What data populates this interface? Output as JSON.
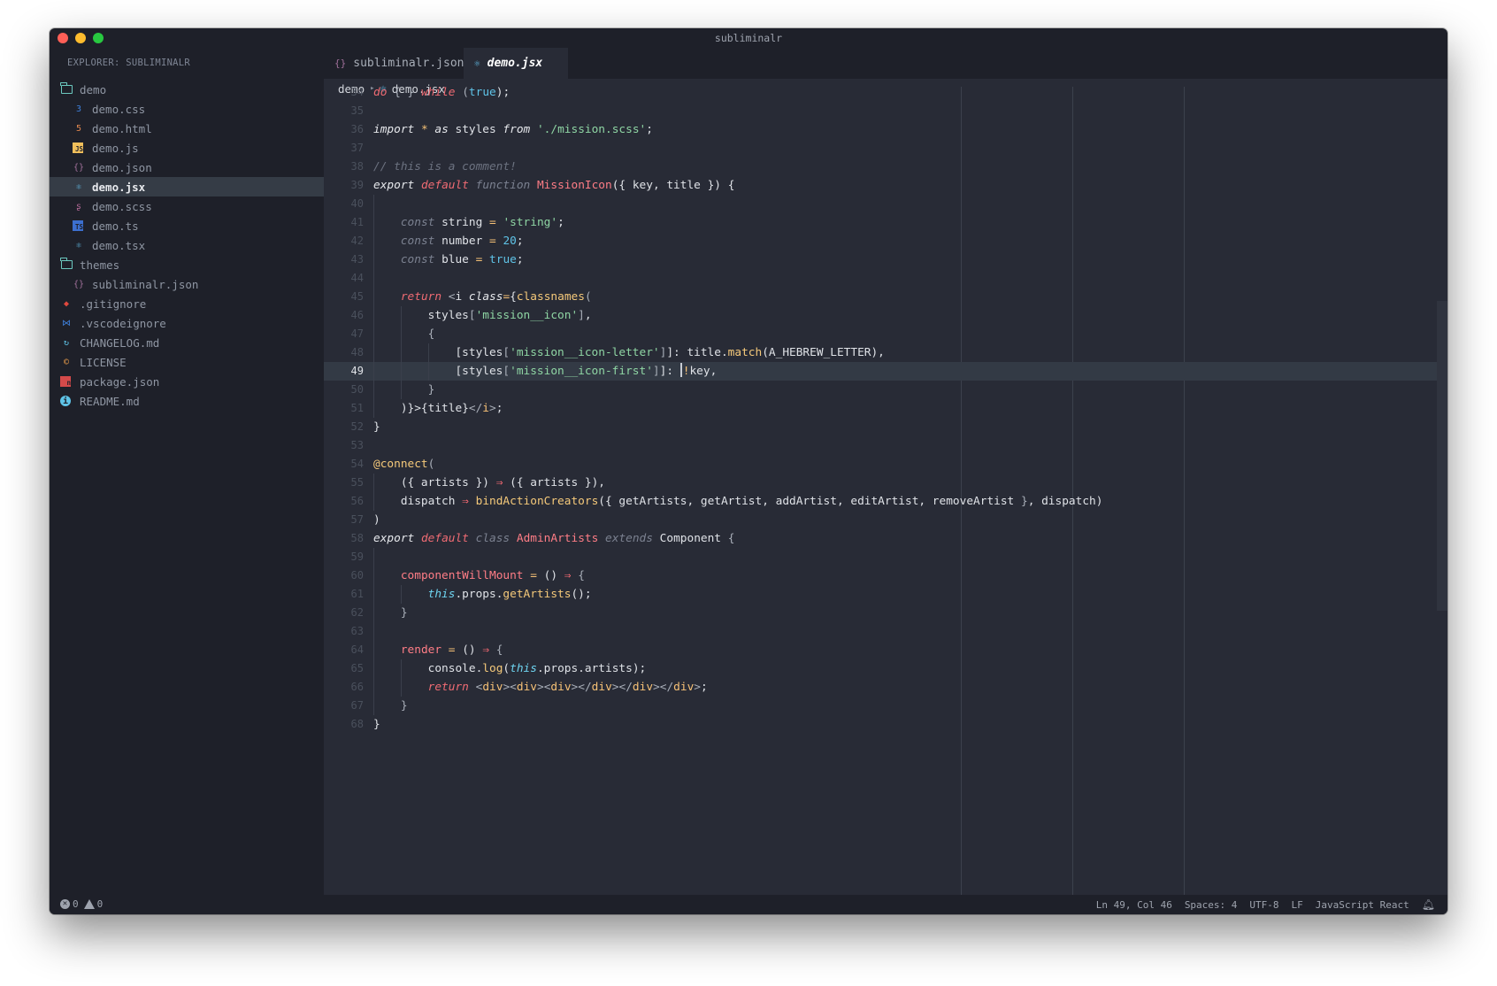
{
  "window": {
    "title": "subliminalr"
  },
  "sidebar": {
    "title": "EXPLORER: SUBLIMINALR",
    "items": [
      {
        "label": "demo",
        "kind": "folder",
        "icon": "folder-icon",
        "level": 0
      },
      {
        "label": "demo.css",
        "kind": "file",
        "icon": "css-icon",
        "icon_glyph": "3",
        "icon_color": "#3f7fd9",
        "level": 1
      },
      {
        "label": "demo.html",
        "kind": "file",
        "icon": "html-icon",
        "icon_glyph": "5",
        "icon_color": "#e0864e",
        "level": 1
      },
      {
        "label": "demo.js",
        "kind": "file",
        "icon": "javascript-icon",
        "icon_glyph": "JS",
        "icon_color": "#f1bf5b",
        "level": 1
      },
      {
        "label": "demo.json",
        "kind": "file",
        "icon": "json-icon",
        "icon_glyph": "{}",
        "icon_color": "#a0709a",
        "level": 1
      },
      {
        "label": "demo.jsx",
        "kind": "file",
        "icon": "react-icon",
        "icon_glyph": "⚛",
        "icon_color": "#5fb4dd",
        "level": 1,
        "active": true
      },
      {
        "label": "demo.scss",
        "kind": "file",
        "icon": "sass-icon",
        "icon_glyph": "ʂ",
        "icon_color": "#b46a98",
        "level": 1
      },
      {
        "label": "demo.ts",
        "kind": "file",
        "icon": "typescript-icon",
        "icon_glyph": "TS",
        "icon_color": "#3c6fcf",
        "level": 1
      },
      {
        "label": "demo.tsx",
        "kind": "file",
        "icon": "react-icon",
        "icon_glyph": "⚛",
        "icon_color": "#5fb4dd",
        "level": 1
      },
      {
        "label": "themes",
        "kind": "folder",
        "icon": "folder-icon",
        "level": 0
      },
      {
        "label": "subliminalr.json",
        "kind": "file",
        "icon": "json-icon",
        "icon_glyph": "{}",
        "icon_color": "#a0709a",
        "level": 1
      },
      {
        "label": ".gitignore",
        "kind": "file",
        "icon": "git-icon",
        "icon_glyph": "◆",
        "icon_color": "#e0483e",
        "level": 0
      },
      {
        "label": ".vscodeignore",
        "kind": "file",
        "icon": "vscode-icon",
        "icon_glyph": "⋈",
        "icon_color": "#3f7fd9",
        "level": 0
      },
      {
        "label": "CHANGELOG.md",
        "kind": "file",
        "icon": "changelog-icon",
        "icon_glyph": "↻",
        "icon_color": "#5fc4e8",
        "level": 0
      },
      {
        "label": "LICENSE",
        "kind": "file",
        "icon": "license-icon",
        "icon_glyph": "©",
        "icon_color": "#f0a04b",
        "level": 0
      },
      {
        "label": "package.json",
        "kind": "file",
        "icon": "npm-icon",
        "icon_glyph": "n",
        "icon_color": "#d44a4a",
        "level": 0
      },
      {
        "label": "README.md",
        "kind": "file",
        "icon": "info-icon",
        "icon_glyph": "i",
        "icon_color": "#5fc4e8",
        "level": 0
      }
    ]
  },
  "tabs": [
    {
      "label": "subliminalr.json",
      "icon": "json-icon",
      "icon_glyph": "{}",
      "active": false
    },
    {
      "label": "demo.jsx",
      "icon": "react-icon",
      "icon_glyph": "⚛",
      "active": true
    }
  ],
  "breadcrumb": {
    "folder": "demo",
    "file": "demo.jsx",
    "separator": "▸"
  },
  "editor": {
    "current_line": 49,
    "lines": [
      {
        "n": 34,
        "tokens": [
          [
            "kw",
            "do"
          ],
          [
            "punc",
            " { } "
          ],
          [
            "kw",
            "while"
          ],
          [
            "punc",
            " ("
          ],
          [
            "num",
            "true"
          ],
          [
            "",
            ");"
          ]
        ]
      },
      {
        "n": 35,
        "tokens": []
      },
      {
        "n": 36,
        "tokens": [
          [
            "dim2",
            "import"
          ],
          [
            "op",
            " * "
          ],
          [
            "dim2",
            "as"
          ],
          [
            "",
            " styles "
          ],
          [
            "dim2",
            "from"
          ],
          [
            "",
            " "
          ],
          [
            "str",
            "'./mission.scss'"
          ],
          [
            "",
            ";"
          ]
        ]
      },
      {
        "n": 37,
        "tokens": []
      },
      {
        "n": 38,
        "tokens": [
          [
            "cmt",
            "// this is a comment!"
          ]
        ]
      },
      {
        "n": 39,
        "tokens": [
          [
            "dim2",
            "export"
          ],
          [
            "",
            " "
          ],
          [
            "kw",
            "default"
          ],
          [
            "",
            " "
          ],
          [
            "dim",
            "function"
          ],
          [
            "",
            " "
          ],
          [
            "cls",
            "MissionIcon"
          ],
          [
            "",
            "({ key, title }) {"
          ]
        ]
      },
      {
        "n": 40,
        "tokens": []
      },
      {
        "n": 41,
        "tokens": [
          [
            "",
            "    "
          ],
          [
            "dim",
            "const"
          ],
          [
            "",
            " string "
          ],
          [
            "op",
            "="
          ],
          [
            "",
            " "
          ],
          [
            "str",
            "'string'"
          ],
          [
            "",
            ";"
          ]
        ]
      },
      {
        "n": 42,
        "tokens": [
          [
            "",
            "    "
          ],
          [
            "dim",
            "const"
          ],
          [
            "",
            " number "
          ],
          [
            "op",
            "="
          ],
          [
            "",
            " "
          ],
          [
            "num",
            "20"
          ],
          [
            "",
            ";"
          ]
        ]
      },
      {
        "n": 43,
        "tokens": [
          [
            "",
            "    "
          ],
          [
            "dim",
            "const"
          ],
          [
            "",
            " blue "
          ],
          [
            "op",
            "="
          ],
          [
            "",
            " "
          ],
          [
            "num",
            "true"
          ],
          [
            "",
            ";"
          ]
        ]
      },
      {
        "n": 44,
        "tokens": []
      },
      {
        "n": 45,
        "tokens": [
          [
            "",
            "    "
          ],
          [
            "kw",
            "return"
          ],
          [
            "",
            " "
          ],
          [
            "punc",
            "<"
          ],
          [
            "",
            "i "
          ],
          [
            "dim2",
            "class"
          ],
          [
            "op",
            "="
          ],
          [
            "",
            "{"
          ],
          [
            "fn",
            "classnames"
          ],
          [
            "punc",
            "("
          ]
        ]
      },
      {
        "n": 46,
        "tokens": [
          [
            "",
            "        styles"
          ],
          [
            "punc",
            "["
          ],
          [
            "str",
            "'mission__icon'"
          ],
          [
            "punc",
            "]"
          ],
          [
            "",
            ","
          ]
        ]
      },
      {
        "n": 47,
        "tokens": [
          [
            "",
            "        "
          ],
          [
            "punc",
            "{"
          ]
        ]
      },
      {
        "n": 48,
        "tokens": [
          [
            "",
            "            [styles"
          ],
          [
            "punc",
            "["
          ],
          [
            "str",
            "'mission__icon-letter'"
          ],
          [
            "punc",
            "]"
          ],
          [
            "",
            "]: title."
          ],
          [
            "fn",
            "match"
          ],
          [
            "",
            "(A_HEBREW_LETTER),"
          ]
        ]
      },
      {
        "n": 49,
        "tokens": [
          [
            "",
            "            [styles"
          ],
          [
            "punc",
            "["
          ],
          [
            "str",
            "'mission__icon-first'"
          ],
          [
            "punc",
            "]"
          ],
          [
            "",
            "]: "
          ],
          [
            "cursor",
            ""
          ],
          [
            "op",
            "!"
          ],
          [
            "",
            "key,"
          ]
        ]
      },
      {
        "n": 50,
        "tokens": [
          [
            "",
            "        "
          ],
          [
            "punc",
            "}"
          ]
        ]
      },
      {
        "n": 51,
        "tokens": [
          [
            "",
            "    )}>{title}"
          ],
          [
            "punc",
            "</"
          ],
          [
            "tag",
            "i"
          ],
          [
            "punc",
            ">"
          ],
          [
            "",
            ";"
          ]
        ]
      },
      {
        "n": 52,
        "tokens": [
          [
            "",
            "}"
          ]
        ]
      },
      {
        "n": 53,
        "tokens": []
      },
      {
        "n": 54,
        "tokens": [
          [
            "fn",
            "@connect"
          ],
          [
            "punc",
            "("
          ]
        ]
      },
      {
        "n": 55,
        "tokens": [
          [
            "",
            "    ({ artists }) "
          ],
          [
            "arrow",
            "⇒"
          ],
          [
            "",
            " ({ artists }),"
          ]
        ]
      },
      {
        "n": 56,
        "tokens": [
          [
            "",
            "    dispatch "
          ],
          [
            "arrow",
            "⇒"
          ],
          [
            "",
            " "
          ],
          [
            "fn",
            "bindActionCreators"
          ],
          [
            "",
            "({ getArtists, getArtist, addArtist, editArtist, removeArtist "
          ],
          [
            "punc",
            "}"
          ],
          [
            "",
            ", dispatch)"
          ]
        ]
      },
      {
        "n": 57,
        "tokens": [
          [
            "",
            ")"
          ]
        ]
      },
      {
        "n": 58,
        "tokens": [
          [
            "dim2",
            "export"
          ],
          [
            "",
            " "
          ],
          [
            "kw",
            "default"
          ],
          [
            "",
            " "
          ],
          [
            "dim",
            "class"
          ],
          [
            "",
            " "
          ],
          [
            "cls",
            "AdminArtists"
          ],
          [
            "",
            " "
          ],
          [
            "dim",
            "extends"
          ],
          [
            "",
            " Component "
          ],
          [
            "punc",
            "{"
          ]
        ]
      },
      {
        "n": 59,
        "tokens": []
      },
      {
        "n": 60,
        "tokens": [
          [
            "",
            "    "
          ],
          [
            "prop",
            "componentWillMount"
          ],
          [
            "",
            " "
          ],
          [
            "op",
            "="
          ],
          [
            "",
            " () "
          ],
          [
            "arrow",
            "⇒"
          ],
          [
            "",
            " "
          ],
          [
            "punc",
            "{"
          ]
        ]
      },
      {
        "n": 61,
        "tokens": [
          [
            "",
            "        "
          ],
          [
            "this",
            "this"
          ],
          [
            "",
            ".props."
          ],
          [
            "fn",
            "getArtists"
          ],
          [
            "",
            "();"
          ]
        ]
      },
      {
        "n": 62,
        "tokens": [
          [
            "",
            "    "
          ],
          [
            "punc",
            "}"
          ]
        ]
      },
      {
        "n": 63,
        "tokens": []
      },
      {
        "n": 64,
        "tokens": [
          [
            "",
            "    "
          ],
          [
            "prop",
            "render"
          ],
          [
            "",
            " "
          ],
          [
            "op",
            "="
          ],
          [
            "",
            " () "
          ],
          [
            "arrow",
            "⇒"
          ],
          [
            "",
            " "
          ],
          [
            "punc",
            "{"
          ]
        ]
      },
      {
        "n": 65,
        "tokens": [
          [
            "",
            "        console."
          ],
          [
            "fn",
            "log"
          ],
          [
            "",
            "("
          ],
          [
            "this",
            "this"
          ],
          [
            "",
            ".props.artists);"
          ]
        ]
      },
      {
        "n": 66,
        "tokens": [
          [
            "",
            "        "
          ],
          [
            "kw",
            "return"
          ],
          [
            "",
            " "
          ],
          [
            "punc",
            "<"
          ],
          [
            "tag",
            "div"
          ],
          [
            "punc",
            "><"
          ],
          [
            "tag",
            "div"
          ],
          [
            "punc",
            "><"
          ],
          [
            "tag",
            "div"
          ],
          [
            "punc",
            "></"
          ],
          [
            "tag",
            "div"
          ],
          [
            "punc",
            "></"
          ],
          [
            "tag",
            "div"
          ],
          [
            "punc",
            "></"
          ],
          [
            "tag",
            "div"
          ],
          [
            "punc",
            ">"
          ],
          [
            "",
            ";"
          ]
        ]
      },
      {
        "n": 67,
        "tokens": [
          [
            "",
            "    "
          ],
          [
            "punc",
            "}"
          ]
        ]
      },
      {
        "n": 68,
        "tokens": [
          [
            "",
            "}"
          ]
        ]
      }
    ]
  },
  "statusbar": {
    "errors": "0",
    "warnings": "0",
    "position": "Ln 49, Col 46",
    "indent": "Spaces: 4",
    "encoding": "UTF-8",
    "eol": "LF",
    "language": "JavaScript React",
    "bell_icon": "bell-icon"
  }
}
